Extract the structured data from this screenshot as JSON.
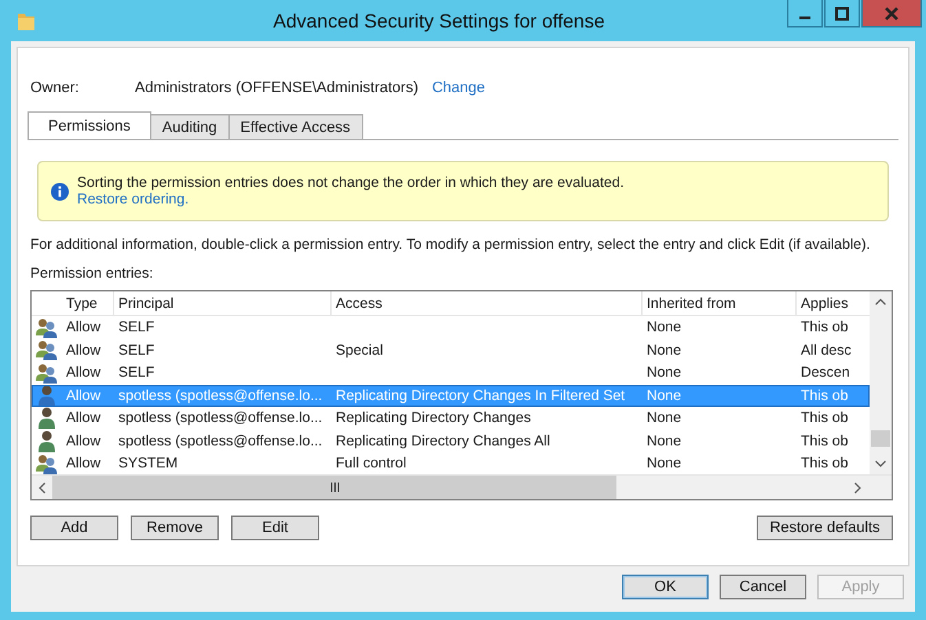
{
  "window": {
    "title": "Advanced Security Settings for offense"
  },
  "owner": {
    "label": "Owner:",
    "value": "Administrators (OFFENSE\\Administrators)",
    "link": "Change"
  },
  "tabs": [
    {
      "label": "Permissions",
      "selected": true
    },
    {
      "label": "Auditing",
      "selected": false
    },
    {
      "label": "Effective Access",
      "selected": false
    }
  ],
  "info": {
    "message": "Sorting the permission entries does not change the order in which they are evaluated.",
    "link": "Restore ordering."
  },
  "instructions": "For additional information, double-click a permission entry. To modify a permission entry, select the entry and click Edit (if available).",
  "entries_label": "Permission entries:",
  "table": {
    "columns": [
      "Type",
      "Principal",
      "Access",
      "Inherited from",
      "Applies"
    ],
    "rows": [
      {
        "kind": "group",
        "type": "Allow",
        "principal": "SELF",
        "inherited_from": "None",
        "applies_to": "This ob",
        "selected": false
      },
      {
        "kind": "group",
        "type": "Allow",
        "principal": "SELF",
        "access": "Special",
        "inherited_from": "None",
        "applies_to": "All desc",
        "selected": false
      },
      {
        "kind": "group",
        "type": "Allow",
        "principal": "SELF",
        "inherited_from": "None",
        "applies_to": "Descen",
        "selected": false
      },
      {
        "kind": "user",
        "type": "Allow",
        "principal": "spotless (spotless@offense.lo...",
        "access": "Replicating Directory Changes In Filtered Set",
        "inherited_from": "None",
        "applies_to": "This ob",
        "selected": true
      },
      {
        "kind": "user",
        "type": "Allow",
        "principal": "spotless (spotless@offense.lo...",
        "access": "Replicating Directory Changes",
        "inherited_from": "None",
        "applies_to": "This ob",
        "selected": false
      },
      {
        "kind": "user",
        "type": "Allow",
        "principal": "spotless (spotless@offense.lo...",
        "access": "Replicating Directory Changes All",
        "inherited_from": "None",
        "applies_to": "This ob",
        "selected": false
      },
      {
        "kind": "group",
        "type": "Allow",
        "principal": "SYSTEM",
        "access": "Full control",
        "inherited_from": "None",
        "applies_to": "This ob",
        "selected": false
      }
    ]
  },
  "entry_buttons": [
    "Add",
    "Remove",
    "Edit"
  ],
  "restore_defaults": "Restore defaults",
  "dialog_buttons": [
    {
      "label": "OK",
      "default": true,
      "disabled": false
    },
    {
      "label": "Cancel",
      "default": false,
      "disabled": false
    },
    {
      "label": "Apply",
      "default": false,
      "disabled": true
    }
  ]
}
